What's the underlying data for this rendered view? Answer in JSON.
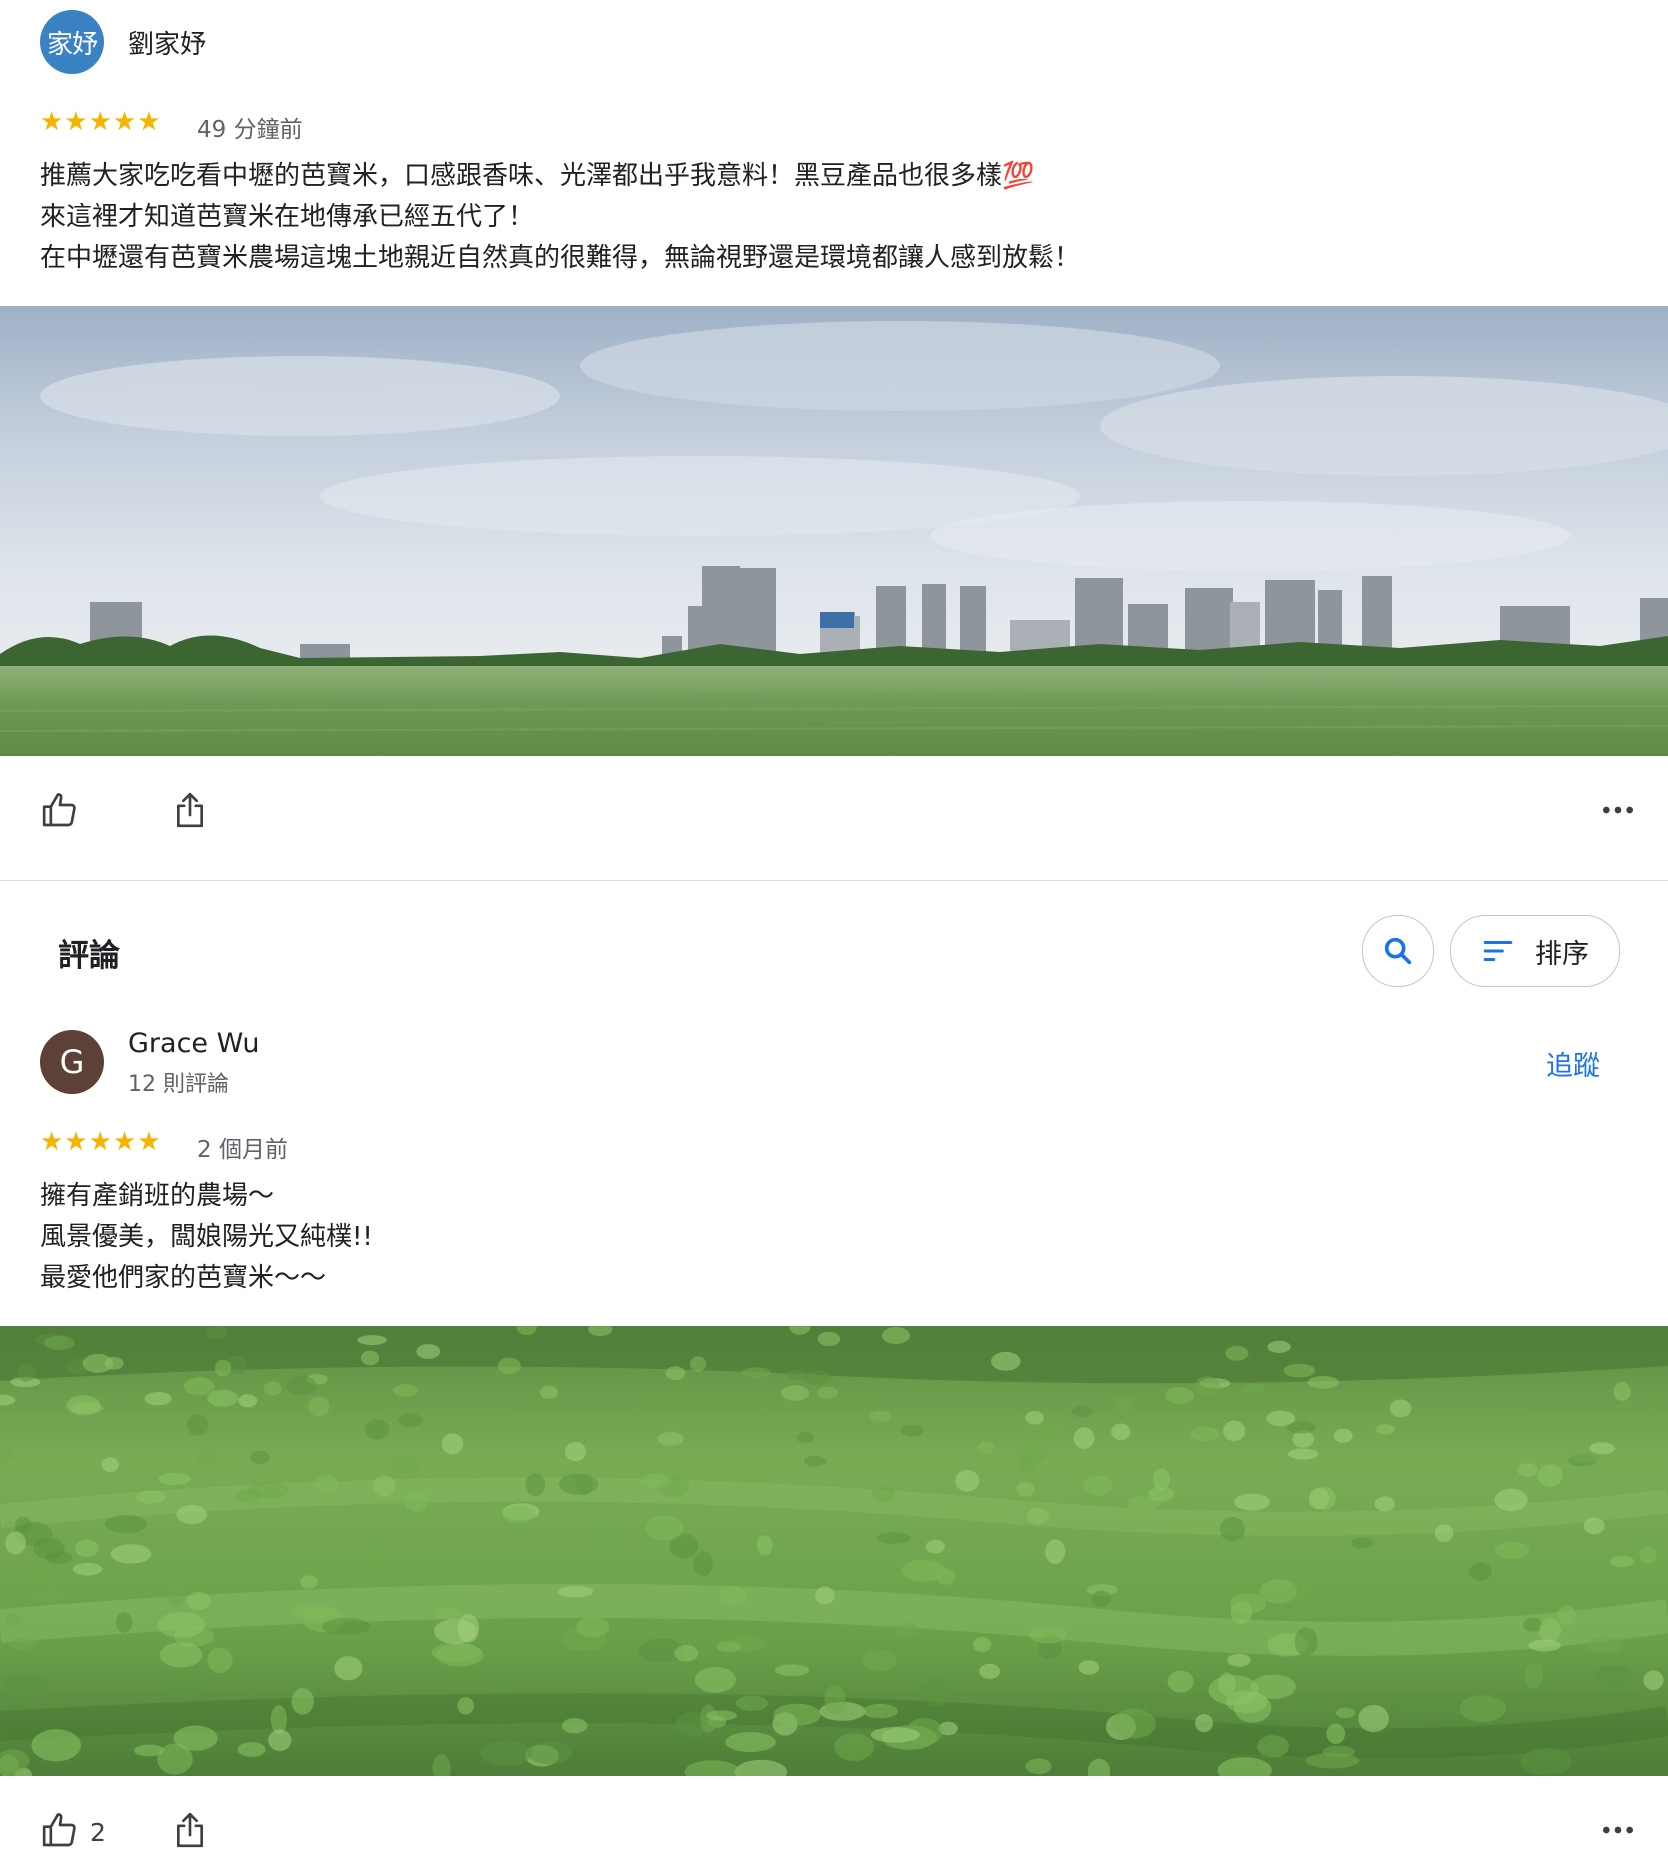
{
  "review1": {
    "avatar_text": "家妤",
    "author": "劉家妤",
    "stars": "★★★★★",
    "time": "49 分鐘前",
    "text": "推薦大家吃吃看中壢的芭寶米，口感跟香味、光澤都出乎我意料！黑豆產品也很多樣💯\n來這裡才知道芭寶米在地傳承已經五代了！\n在中壢還有芭寶米農場這塊土地親近自然真的很難得，無論視野還是環境都讓人感到放鬆！",
    "photo": "farmland-with-city-skyline"
  },
  "reviews_section": {
    "title": "評論",
    "search_icon": "search-icon",
    "sort_icon": "sort-lines-icon",
    "sort_label": "排序"
  },
  "review2": {
    "avatar_text": "G",
    "author": "Grace Wu",
    "review_count": "12 則評論",
    "follow_label": "追蹤",
    "stars": "★★★★★",
    "time": "2 個月前",
    "text": "擁有產銷班的農場～\n風景優美，闆娘陽光又純樸!!\n最愛他們家的芭寶米～～",
    "like_count": "2",
    "photo": "soybean-field-closeup"
  },
  "icons": {
    "like": "thumbs-up-icon",
    "share": "share-icon",
    "more": "more-horizontal-icon"
  },
  "colors": {
    "star": "#f4b400",
    "link": "#1a73e8",
    "avatar1": "#3b82c4",
    "avatar2": "#5d4037"
  }
}
